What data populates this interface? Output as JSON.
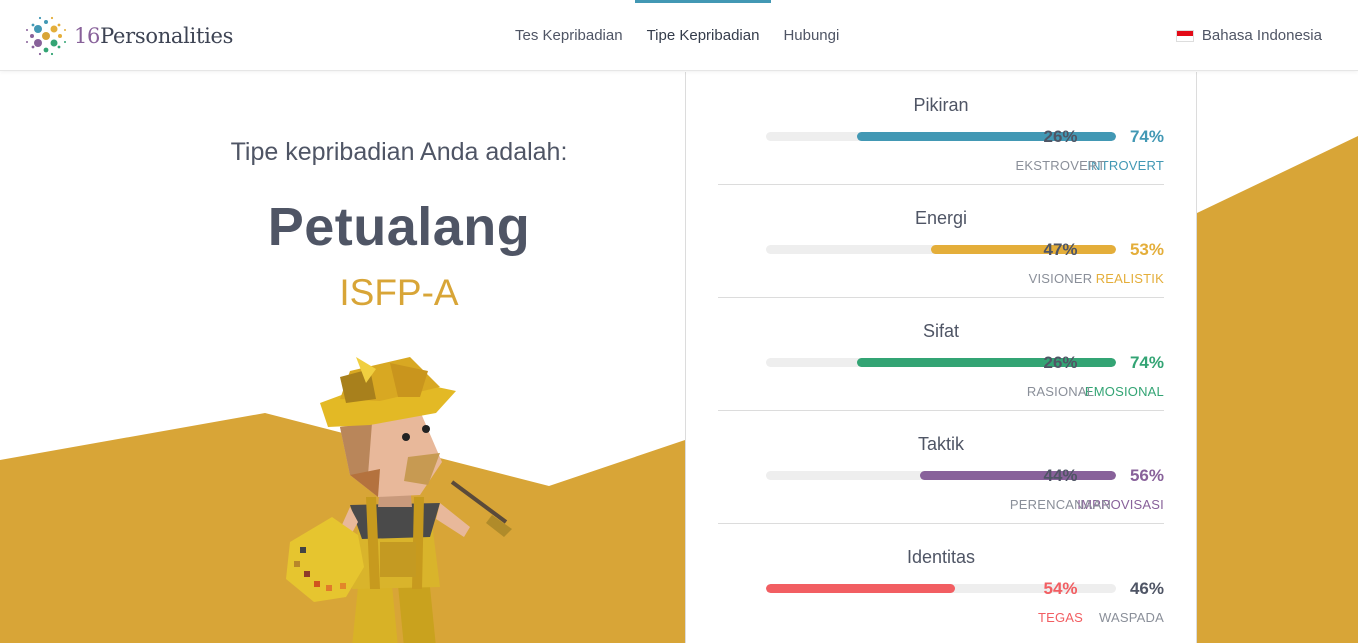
{
  "header": {
    "logo": {
      "number": "16",
      "word": "Personalities"
    },
    "nav": [
      "Tes Kepribadian",
      "Tipe Kepribadian",
      "Hubungi"
    ],
    "active_nav_index": 1,
    "language": "Bahasa Indonesia",
    "accent_color": "#4298b4"
  },
  "result": {
    "intro": "Tipe kepribadian Anda adalah:",
    "type_name": "Petualang",
    "type_code": "ISFP-A",
    "accent_color": "#d8a537"
  },
  "traits": [
    {
      "title": "Pikiran",
      "left_pct": "26%",
      "right_pct": "74%",
      "left_label": "EKSTROVERT",
      "right_label": "INTROVERT",
      "dominant": "right",
      "value": 0.74,
      "color": "#4298b4"
    },
    {
      "title": "Energi",
      "left_pct": "47%",
      "right_pct": "53%",
      "left_label": "VISIONER",
      "right_label": "REALISTIK",
      "dominant": "right",
      "value": 0.53,
      "color": "#e4ae3a"
    },
    {
      "title": "Sifat",
      "left_pct": "26%",
      "right_pct": "74%",
      "left_label": "RASIONAL",
      "right_label": "EMOSIONAL",
      "dominant": "right",
      "value": 0.74,
      "color": "#33a474"
    },
    {
      "title": "Taktik",
      "left_pct": "44%",
      "right_pct": "56%",
      "left_label": "PERENCANAAN",
      "right_label": "IMPROVISASI",
      "dominant": "right",
      "value": 0.56,
      "color": "#88619a"
    },
    {
      "title": "Identitas",
      "left_pct": "54%",
      "right_pct": "46%",
      "left_label": "TEGAS",
      "right_label": "WASPADA",
      "dominant": "left",
      "value": 0.54,
      "color": "#f25e62"
    }
  ]
}
